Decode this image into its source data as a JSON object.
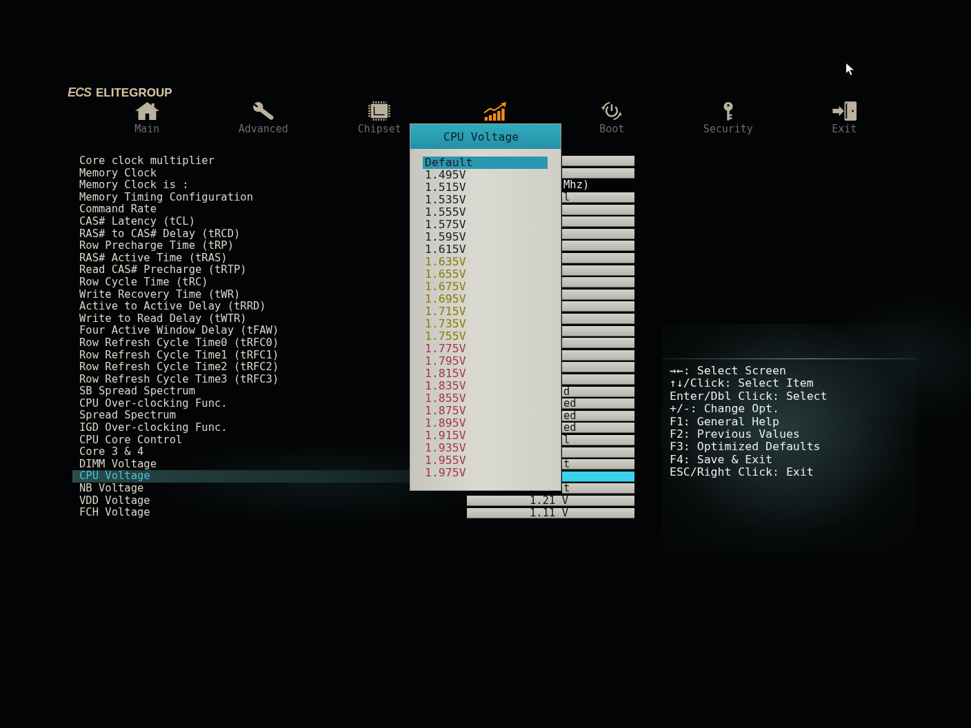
{
  "brand": {
    "mark": "ECS",
    "name": "ELITEGROUP"
  },
  "tabs": [
    {
      "label": "Main",
      "selected": false
    },
    {
      "label": "Advanced",
      "selected": false
    },
    {
      "label": "Chipset",
      "selected": false
    },
    {
      "selected": true
    },
    {
      "label": "Boot",
      "selected": false
    },
    {
      "label": "Security",
      "selected": false
    },
    {
      "label": "Exit",
      "selected": false
    }
  ],
  "settings": [
    {
      "label": "Core clock multiplier",
      "kind": "field",
      "selected": false
    },
    {
      "label": "Memory Clock",
      "kind": "field",
      "selected": false
    },
    {
      "label": "Memory Clock is :",
      "kind": "info",
      "selected": false,
      "value": "Mhz)"
    },
    {
      "label": "Memory Timing Configuration",
      "kind": "field",
      "selected": false,
      "value": "l"
    },
    {
      "label": "Command Rate",
      "kind": "field",
      "selected": false
    },
    {
      "label": "CAS# Latency (tCL)",
      "kind": "field",
      "selected": false
    },
    {
      "label": "RAS# to CAS# Delay (tRCD)",
      "kind": "field",
      "selected": false
    },
    {
      "label": "Row Precharge Time (tRP)",
      "kind": "field",
      "selected": false
    },
    {
      "label": "RAS# Active Time (tRAS)",
      "kind": "field",
      "selected": false
    },
    {
      "label": "Read CAS# Precharge (tRTP)",
      "kind": "field",
      "selected": false
    },
    {
      "label": "Row Cycle Time (tRC)",
      "kind": "field",
      "selected": false
    },
    {
      "label": "Write Recovery Time (tWR)",
      "kind": "field",
      "selected": false
    },
    {
      "label": "Active to Active Delay (tRRD)",
      "kind": "field",
      "selected": false
    },
    {
      "label": "Write to Read Delay (tWTR)",
      "kind": "field",
      "selected": false
    },
    {
      "label": "Four Active Window Delay (tFAW)",
      "kind": "field",
      "selected": false
    },
    {
      "label": "Row Refresh Cycle Time0 (tRFC0)",
      "kind": "field",
      "selected": false
    },
    {
      "label": "Row Refresh Cycle Time1 (tRFC1)",
      "kind": "field",
      "selected": false
    },
    {
      "label": "Row Refresh Cycle Time2 (tRFC2)",
      "kind": "field",
      "selected": false
    },
    {
      "label": "Row Refresh Cycle Time3 (tRFC3)",
      "kind": "field",
      "selected": false
    },
    {
      "label": "SB Spread Spectrum",
      "kind": "field",
      "selected": false,
      "value": "d"
    },
    {
      "label": "CPU Over-clocking Func.",
      "kind": "field",
      "selected": false,
      "value": "ed"
    },
    {
      "label": "Spread Spectrum",
      "kind": "field",
      "selected": false,
      "value": "ed"
    },
    {
      "label": "IGD Over-clocking Func.",
      "kind": "field",
      "selected": false,
      "value": "ed"
    },
    {
      "label": "CPU Core Control",
      "kind": "field",
      "selected": false,
      "value": "l"
    },
    {
      "label": "Core 3 & 4",
      "kind": "field",
      "selected": false
    },
    {
      "label": "DIMM Voltage",
      "kind": "field",
      "selected": false,
      "value": "t"
    },
    {
      "label": "CPU Voltage",
      "kind": "field",
      "selected": true
    },
    {
      "label": "NB Voltage",
      "kind": "field",
      "selected": false,
      "value": "t"
    },
    {
      "label": "VDD Voltage",
      "kind": "field",
      "selected": false,
      "value": "1.21 V"
    },
    {
      "label": "FCH Voltage",
      "kind": "field",
      "selected": false,
      "value": "1.11 V"
    }
  ],
  "popup": {
    "title": "CPU Voltage",
    "items": [
      {
        "label": "Default",
        "selected": true,
        "color": "#1c1c1c"
      },
      {
        "label": "1.495V",
        "selected": false,
        "color": "#1c1c1c"
      },
      {
        "label": "1.515V",
        "selected": false,
        "color": "#1c1c1c"
      },
      {
        "label": "1.535V",
        "selected": false,
        "color": "#1c1c1c"
      },
      {
        "label": "1.555V",
        "selected": false,
        "color": "#1c1c1c"
      },
      {
        "label": "1.575V",
        "selected": false,
        "color": "#1c1c1c"
      },
      {
        "label": "1.595V",
        "selected": false,
        "color": "#1c1c1c"
      },
      {
        "label": "1.615V",
        "selected": false,
        "color": "#1c1c1c"
      },
      {
        "label": "1.635V",
        "selected": false,
        "color": "#8c7a00"
      },
      {
        "label": "1.655V",
        "selected": false,
        "color": "#8c7a00"
      },
      {
        "label": "1.675V",
        "selected": false,
        "color": "#8c7a00"
      },
      {
        "label": "1.695V",
        "selected": false,
        "color": "#8c7a00"
      },
      {
        "label": "1.715V",
        "selected": false,
        "color": "#8c7a00"
      },
      {
        "label": "1.735V",
        "selected": false,
        "color": "#8c7a00"
      },
      {
        "label": "1.755V",
        "selected": false,
        "color": "#8c7a00"
      },
      {
        "label": "1.775V",
        "selected": false,
        "color": "#a83448"
      },
      {
        "label": "1.795V",
        "selected": false,
        "color": "#a83448"
      },
      {
        "label": "1.815V",
        "selected": false,
        "color": "#a83448"
      },
      {
        "label": "1.835V",
        "selected": false,
        "color": "#a83448"
      },
      {
        "label": "1.855V",
        "selected": false,
        "color": "#a83448"
      },
      {
        "label": "1.875V",
        "selected": false,
        "color": "#a83448"
      },
      {
        "label": "1.895V",
        "selected": false,
        "color": "#a83448"
      },
      {
        "label": "1.915V",
        "selected": false,
        "color": "#a83448"
      },
      {
        "label": "1.935V",
        "selected": false,
        "color": "#a83448"
      },
      {
        "label": "1.955V",
        "selected": false,
        "color": "#a83448"
      },
      {
        "label": "1.975V",
        "selected": false,
        "color": "#a83448"
      }
    ]
  },
  "help": [
    "→←: Select Screen",
    "↑↓/Click: Select Item",
    "Enter/Dbl Click: Select",
    "+/-: Change Opt.",
    "F1: General Help",
    "F2: Previous Values",
    "F3: Optimized Defaults",
    "F4: Save & Exit",
    "ESC/Right Click: Exit"
  ]
}
